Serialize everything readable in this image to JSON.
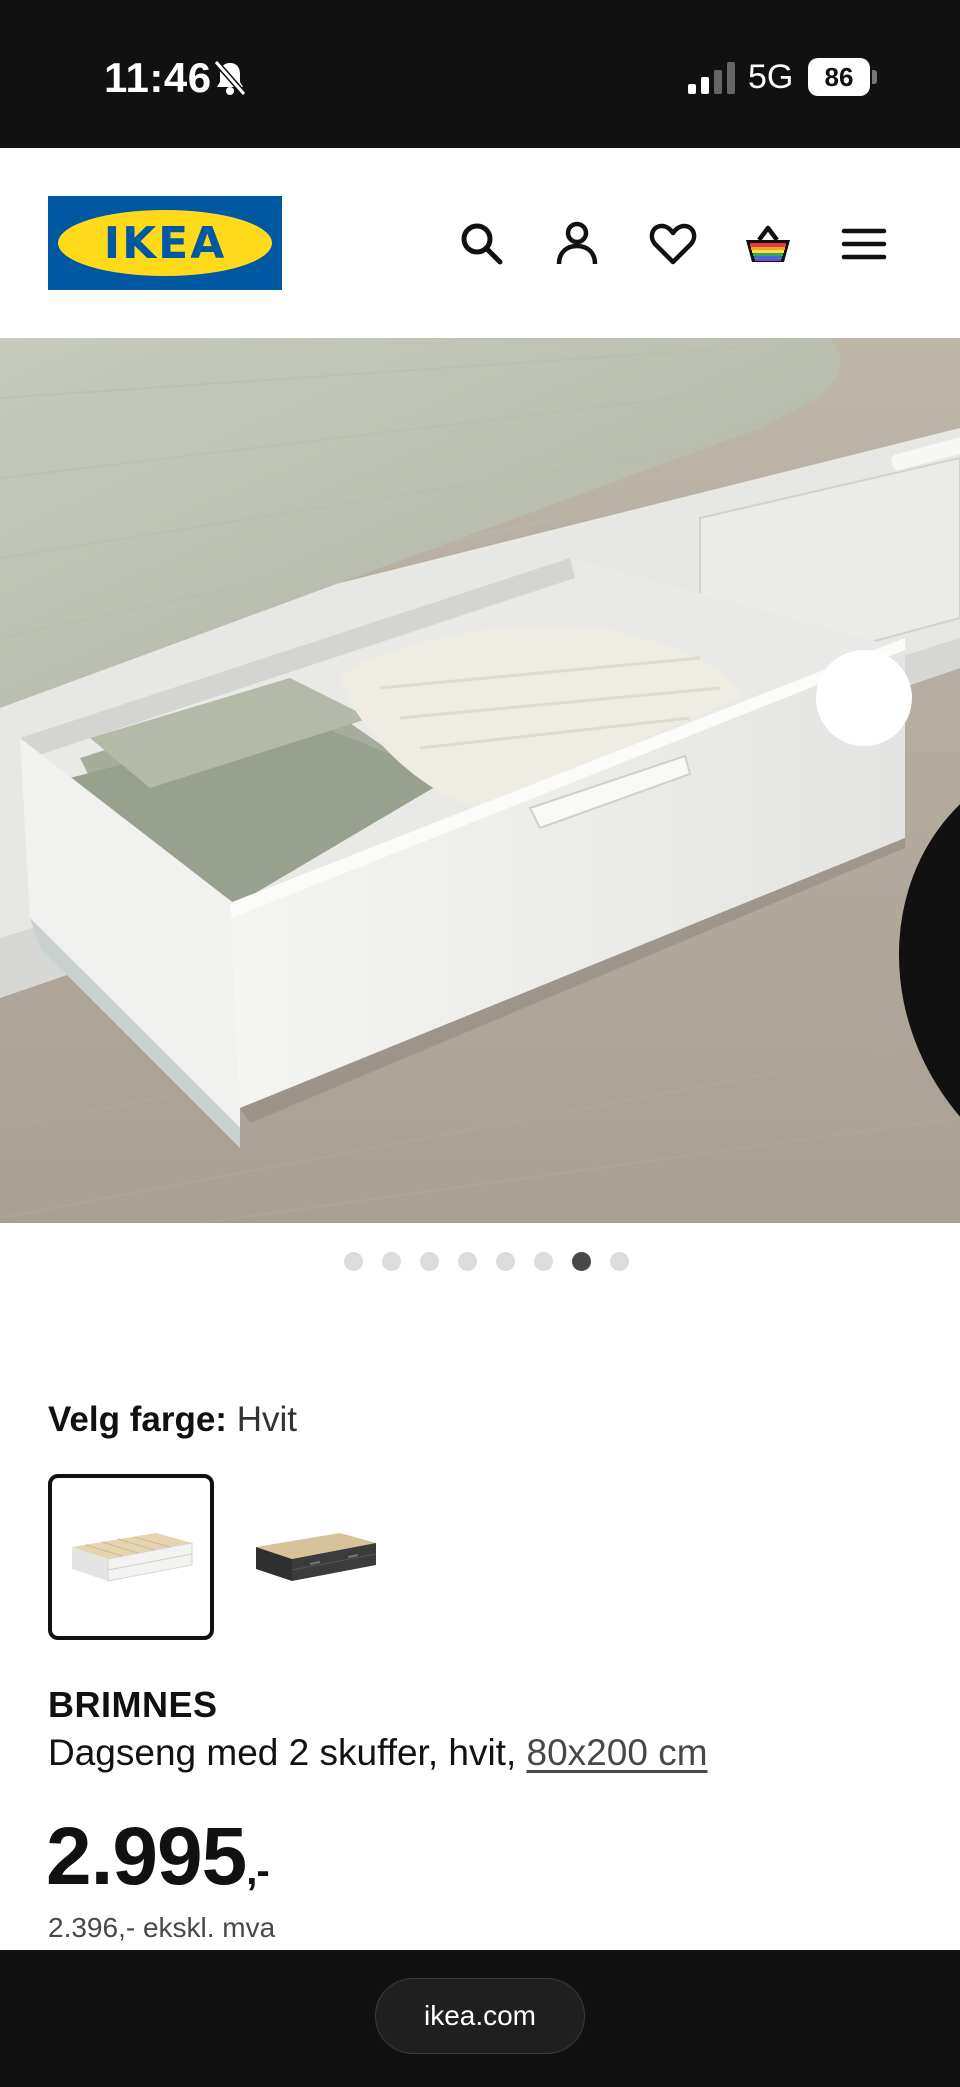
{
  "status_bar": {
    "time": "11:46",
    "network": "5G",
    "battery": "86"
  },
  "header": {
    "logo_text": "IKEA",
    "icons": [
      "search-icon",
      "profile-icon",
      "heart-icon",
      "basket-icon",
      "menu-icon"
    ]
  },
  "hero": {
    "image_count": 8,
    "active_index": 6
  },
  "color_select": {
    "label": "Velg farge:",
    "value": "Hvit",
    "options": [
      "white-daybed-thumbnail",
      "black-daybed-thumbnail"
    ],
    "selected_index": 0
  },
  "product": {
    "name": "BRIMNES",
    "description": "Dagseng med 2 skuffer, hvit,",
    "size": "80x200 cm",
    "price": "2.995",
    "price_suffix": ",-",
    "price_ex_vat": "2.396,- ekskl. mva"
  },
  "browser": {
    "url": "ikea.com"
  },
  "colors": {
    "brand_blue": "#0058a3",
    "brand_yellow": "#ffda1a",
    "bar_black": "#111111"
  }
}
